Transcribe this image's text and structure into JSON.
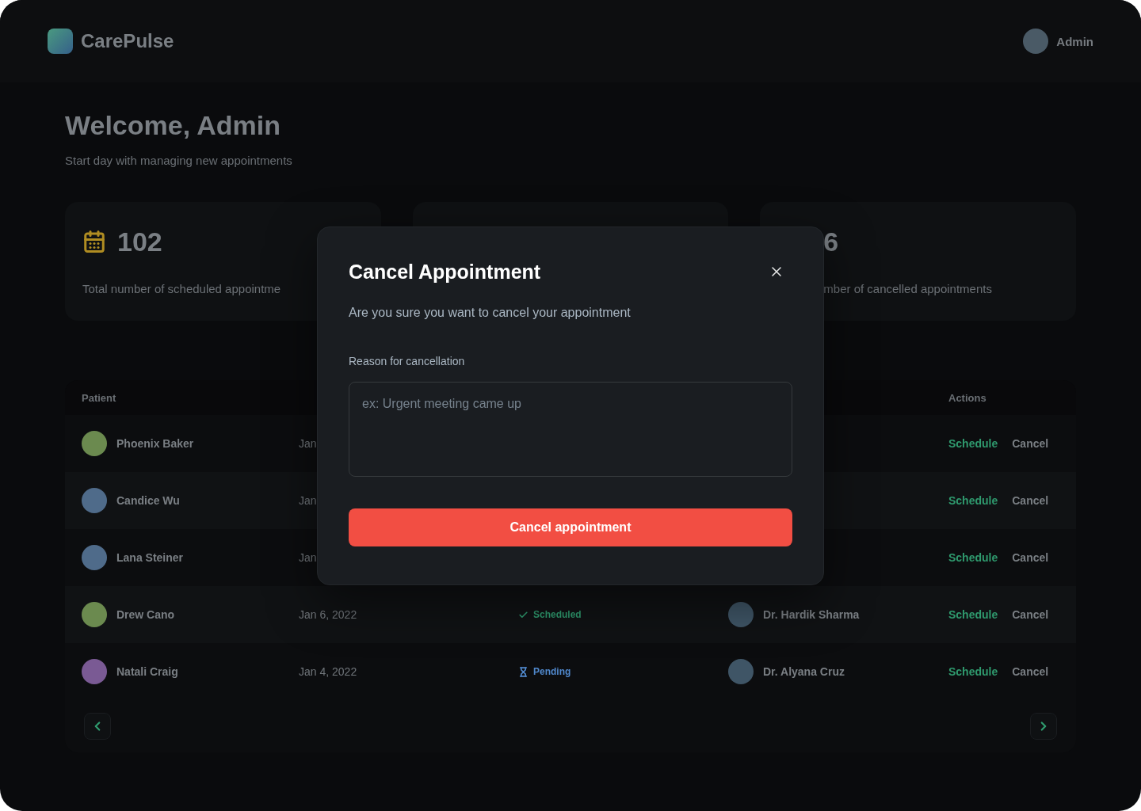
{
  "header": {
    "brand": "CarePulse",
    "user": "Admin"
  },
  "welcome": {
    "title": "Welcome, Admin",
    "subtitle": "Start day with managing new appointments"
  },
  "stats": [
    {
      "kind": "scheduled",
      "count": "102",
      "label": "Total number of scheduled appointme"
    },
    {
      "count": "6",
      "label": "mber of cancelled appointments"
    }
  ],
  "table": {
    "header": {
      "patient": "Patient",
      "actions": "Actions"
    },
    "rows": [
      {
        "patient": "Phoenix Baker",
        "color": "#6b8a4f",
        "date": "Jan",
        "actions": [
          {
            "kind": "schedule",
            "label": "Schedule"
          },
          {
            "kind": "cancel",
            "label": "Cancel"
          }
        ]
      },
      {
        "patient": "Candice Wu",
        "color": "#4f6b8a",
        "date": "Jan",
        "actions": [
          {
            "kind": "schedule",
            "label": "Schedule"
          },
          {
            "kind": "cancel",
            "label": "Cancel"
          }
        ]
      },
      {
        "patient": "Lana Steiner",
        "color": "#4f6b8a",
        "date": "Jan",
        "actions": [
          {
            "kind": "schedule",
            "label": "Schedule"
          },
          {
            "kind": "cancel",
            "label": "Cancel"
          }
        ]
      },
      {
        "patient": "Drew Cano",
        "color": "#6b8a4f",
        "date": "Jan 6, 2022",
        "status": {
          "kind": "scheduled",
          "label": "Scheduled"
        },
        "doctor": "Dr. Hardik Sharma",
        "actions": [
          {
            "kind": "schedule",
            "label": "Schedule"
          },
          {
            "kind": "cancel",
            "label": "Cancel"
          }
        ]
      },
      {
        "patient": "Natali Craig",
        "color": "#7a5a94",
        "date": "Jan 4, 2022",
        "status": {
          "kind": "pending",
          "label": "Pending"
        },
        "doctor": "Dr. Alyana Cruz",
        "actions": [
          {
            "kind": "schedule",
            "label": "Schedule"
          },
          {
            "kind": "cancel",
            "label": "Cancel"
          }
        ]
      }
    ]
  },
  "dialog": {
    "title": "Cancel Appointment",
    "description": "Are you sure you want to cancel your appointment",
    "field": {
      "label": "Reason for cancellation",
      "placeholder": "ex: Urgent meeting came up"
    },
    "submit": "Cancel appointment"
  }
}
